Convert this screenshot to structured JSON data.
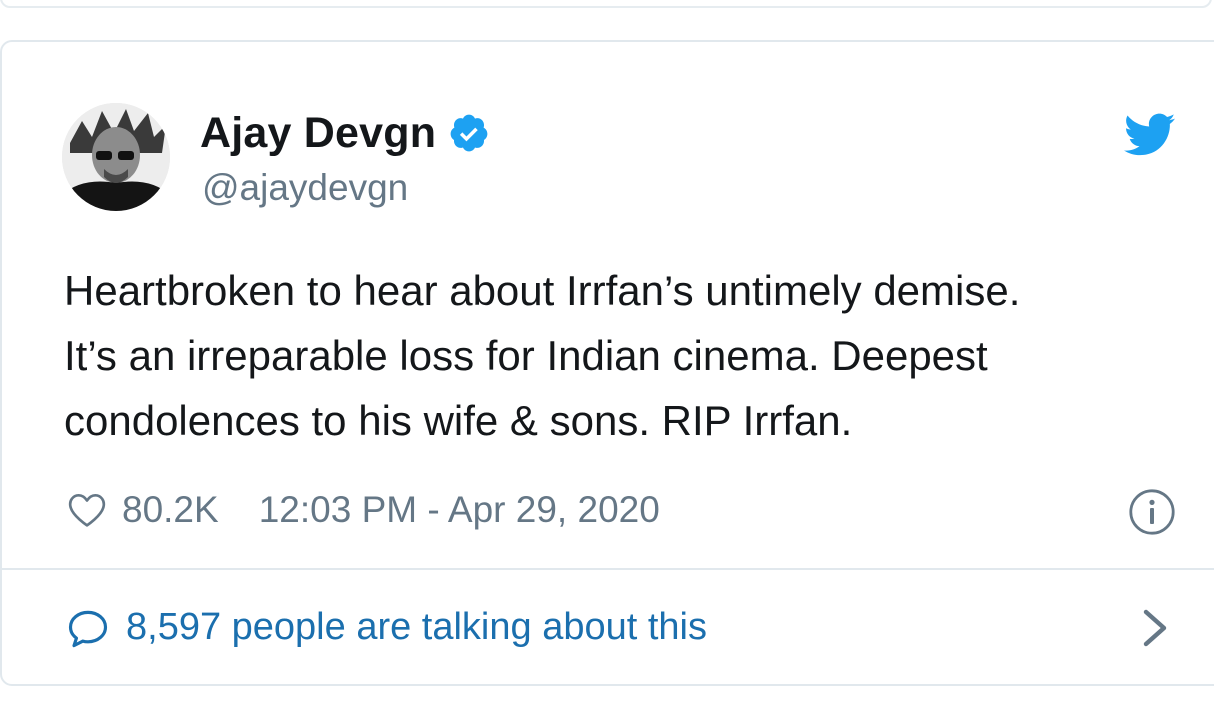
{
  "tweet": {
    "author": {
      "name": "Ajay Devgn",
      "handle": "@ajaydevgn",
      "verified": true
    },
    "text_lines": [
      "Heartbroken to hear about Irrfan’s untimely demise.",
      "It’s an irreparable loss for Indian cinema. Deepest",
      "condolences to his wife & sons. RIP Irrfan."
    ],
    "likes": "80.2K",
    "timestamp": "12:03 PM - Apr 29, 2020",
    "talking": "8,597 people are talking about this"
  },
  "icons": {
    "brand": "twitter-bird-icon",
    "verified": "verified-badge-icon",
    "like": "heart-icon",
    "info": "info-icon",
    "reply": "speech-bubble-icon",
    "more": "chevron-right-icon"
  },
  "colors": {
    "twitter_blue": "#1da1f2",
    "link_blue": "#1b6fae",
    "text_primary": "#14171a",
    "text_secondary": "#657786",
    "border": "#e1e8ed"
  }
}
